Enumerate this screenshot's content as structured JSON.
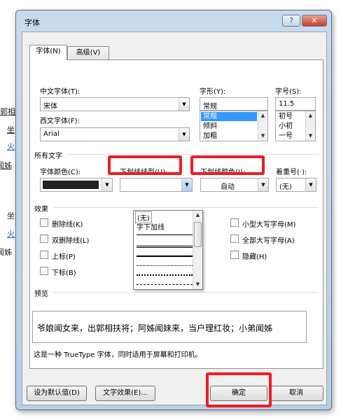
{
  "background_doc": {
    "fragments": [
      "郭相",
      "坐",
      "火",
      "弟闻姊",
      "坐",
      "火",
      "弟闻姊"
    ]
  },
  "dialog": {
    "title": "字体",
    "help_symbol": "?",
    "close_symbol": "✕",
    "tabs": [
      {
        "label": "字体(N)",
        "selected": true
      },
      {
        "label": "高级(V)",
        "selected": false
      }
    ],
    "chinese_font": {
      "label": "中文字体(T):",
      "value": "宋体"
    },
    "western_font": {
      "label": "西文字体(F):",
      "value": "Arial"
    },
    "font_style": {
      "label": "字形(Y):",
      "value": "常规",
      "options": [
        "常规",
        "倾斜",
        "加粗"
      ],
      "selected": "常规"
    },
    "font_size": {
      "label": "字号(S):",
      "value": "11.5",
      "options": [
        "初号",
        "小初",
        "一号"
      ]
    },
    "all_text_label": "所有文字",
    "font_color": {
      "label": "字体颜色(C):",
      "color": "#222222"
    },
    "underline_style": {
      "label": "下划线线型(U):",
      "value": ""
    },
    "underline_color": {
      "label": "下划线颜色(I):",
      "value": "自动"
    },
    "emphasis_mark": {
      "label": "着重号(·):",
      "value": "(无)"
    },
    "underline_dropdown": {
      "items": [
        "(无)",
        "字下加线"
      ],
      "line_styles": [
        "single",
        "double",
        "thick",
        "dotted",
        "dense-dotted",
        "dashed"
      ]
    },
    "effects_label": "效果",
    "effects": {
      "strikethrough": "删除线(K)",
      "double_strikethrough": "双删除线(L)",
      "superscript": "上标(P)",
      "subscript": "下标(B)",
      "small_caps": "小型大写字母(M)",
      "all_caps": "全部大写字母(A)",
      "hidden": "隐藏(H)"
    },
    "preview_label": "预览",
    "preview_text": "爷娘闻女来，出郭相扶将；阿姊闻妹来，当户理红妆；小弟闻姊",
    "description": "这是一种 TrueType 字体，同时适用于屏幕和打印机。",
    "buttons": {
      "set_default": "设为默认值(D)",
      "text_effects": "文字效果(E)...",
      "ok": "确定",
      "cancel": "取消"
    },
    "highlight_color": "#ee1c24",
    "selection_color": "#3399ff"
  }
}
